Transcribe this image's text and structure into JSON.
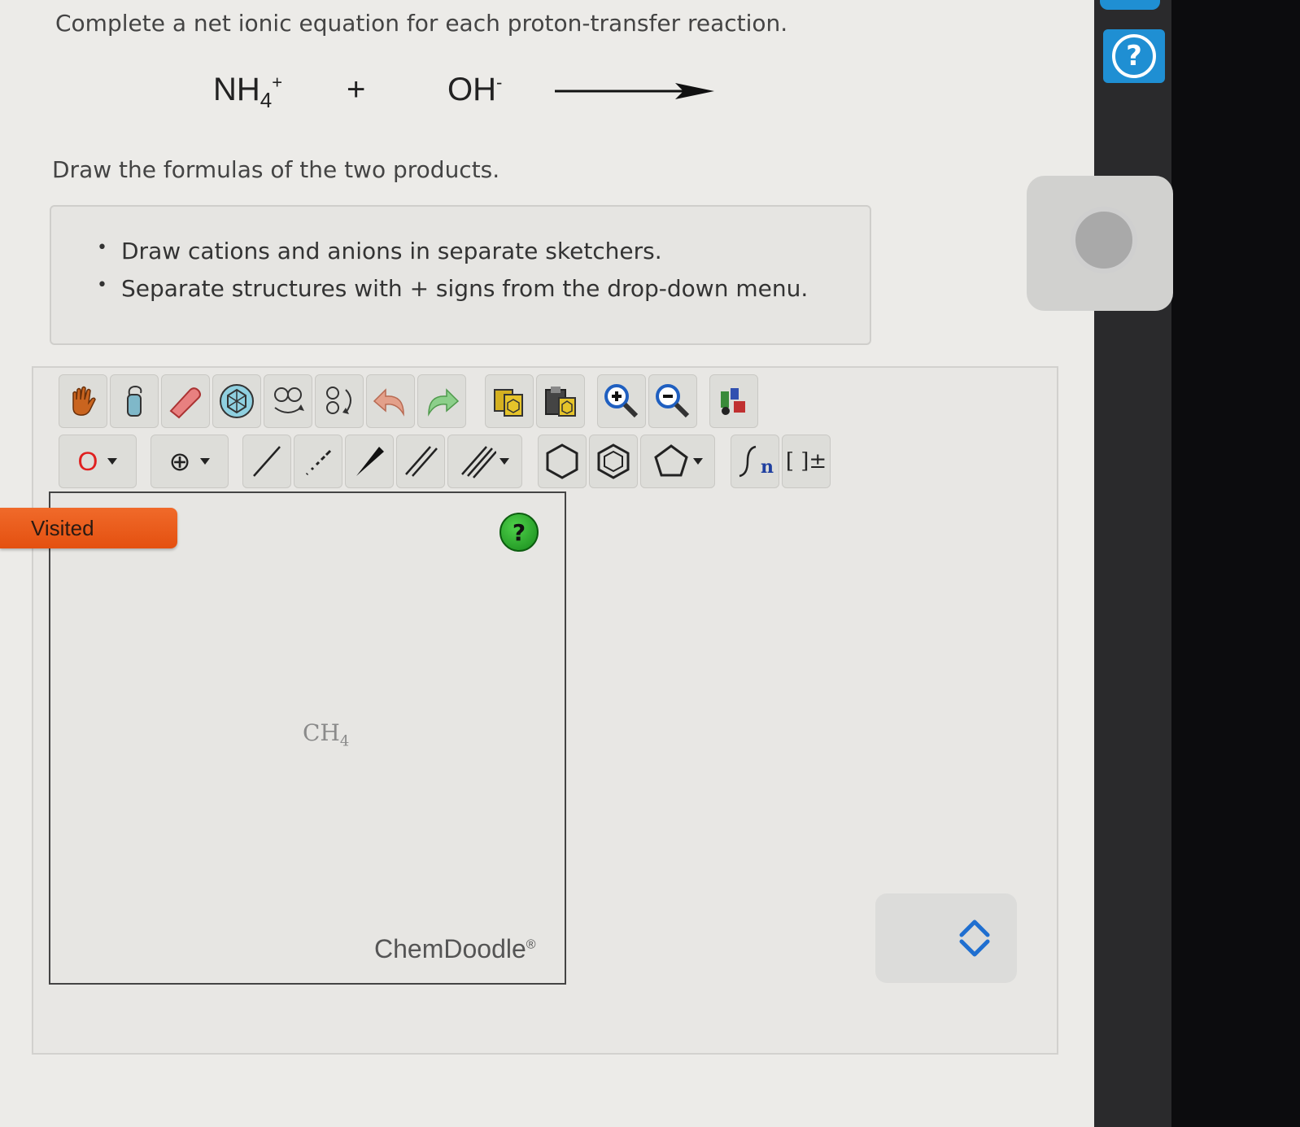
{
  "question": {
    "prompt": "Complete a net ionic equation for each proton-transfer reaction.",
    "equation": {
      "reactant1_base": "NH",
      "reactant1_sub": "4",
      "reactant1_sup": "+",
      "plus": "+",
      "reactant2_base": "OH",
      "reactant2_sup": "-"
    },
    "instruction": "Draw the formulas of the two products."
  },
  "notes": [
    "Draw cations and anions in separate sketchers.",
    "Separate structures with + signs from the drop-down menu."
  ],
  "toolbar": {
    "row1": [
      "hand-icon",
      "lasso-icon",
      "eraser-icon",
      "clean-icon",
      "flip-icon",
      "rotate-icon",
      "undo-icon",
      "redo-icon",
      "copy-icon",
      "paste-icon",
      "zoom-in-icon",
      "zoom-out-icon",
      "settings-icon"
    ],
    "atom_label": "O",
    "charge_label": "⊕",
    "repeat_label": "n",
    "bracket_label": "[ ]±"
  },
  "sketcher": {
    "content_base": "CH",
    "content_sub": "4",
    "help_label": "?",
    "brand": "ChemDoodle",
    "brand_mark": "®"
  },
  "visited_label": "Visited",
  "help_label": "?",
  "colors": {
    "visited": "#e85a1a",
    "help_green": "#2fae2c",
    "help_blue": "#1f8fd3",
    "atom_red": "#e02020"
  }
}
